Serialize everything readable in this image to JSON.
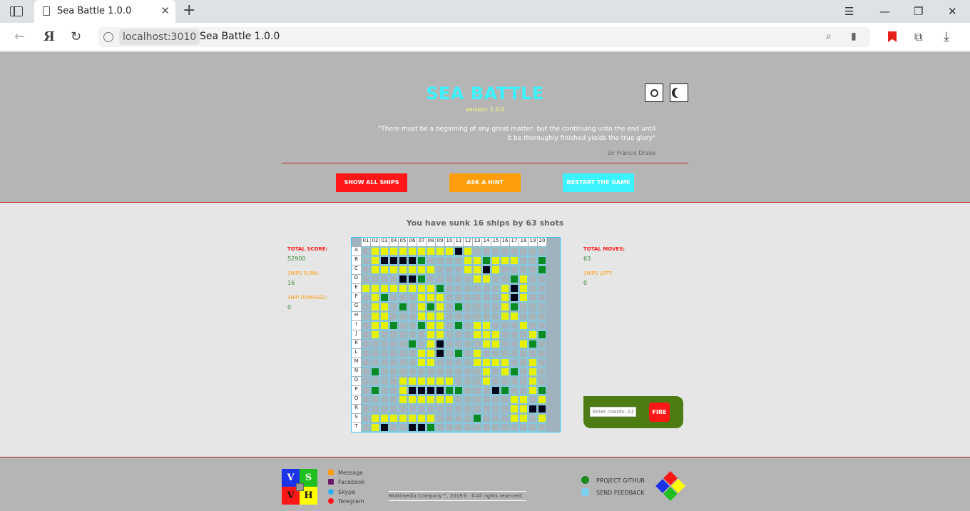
{
  "browser": {
    "tab_title": "Sea Battle 1.0.0",
    "address_host": "localhost:3010",
    "address_title": "Sea Battle 1.0.0"
  },
  "header": {
    "title": "SEA BATTLE",
    "version": "version: 1.0.0",
    "quote": "\"There must be a beginning of any great matter, but the continuing unto the end until it be thoroughly finished yields the true glory\"",
    "quote_author": "Sir Francis Drake",
    "buttons": {
      "show_all_ships": "SHOW ALL SHIPS",
      "ask_hint": "ASK A HINT",
      "restart": "RESTART THE GAME"
    },
    "colors": {
      "title": "#3cf2ff",
      "show_all_ships": "#ff1616",
      "ask_hint": "#ff9e0c",
      "restart": "#3cf2ff"
    }
  },
  "game": {
    "status": "You have sunk 16 ships by 63 shots",
    "stats": {
      "total_score_label": "TOTAL SCORE:",
      "total_score": "52900",
      "ships_sunk_label": "SHIPS SUNK:",
      "ships_sunk": "16",
      "ship_damages_label": "SHIP DAMAGES:",
      "ship_damages": "0",
      "total_moves_label": "TOTAL MOVES:",
      "total_moves": "63",
      "ships_left_label": "SHIPS LEFT:",
      "ships_left": "0"
    },
    "columns": [
      "01",
      "02",
      "03",
      "04",
      "05",
      "06",
      "07",
      "08",
      "09",
      "10",
      "11",
      "12",
      "13",
      "14",
      "15",
      "16",
      "17",
      "18",
      "19",
      "20"
    ],
    "rows": [
      "A",
      "B",
      "C",
      "D",
      "E",
      "F",
      "G",
      "H",
      "I",
      "J",
      "K",
      "L",
      "M",
      "N",
      "O",
      "P",
      "Q",
      "R",
      "S",
      "T"
    ],
    "cell_legend": {
      "e": "unopened",
      "y": "revealed",
      "k": "ship",
      "g": "hit"
    },
    "grid": [
      "eyyyyyyyyykyeeeeeeee",
      "eykkkkgeeeeyygyyyeeg",
      "eyyyyyyyeeeyykyeeeeg",
      "eeeekkgeeeeeyyeegyee",
      "yyyyyyyygeeeeeeykyee",
      "eygeeeyyyeeeeeeykyee",
      "eyyegeygyegeeeeygeee",
      "eyyeeeyyyeeeeeeyyeee",
      "eyygeegyyegeyyeeeyee",
      "eyeeeeeyyeeeyyyeeeyg",
      "eeeeegeykeeeeyyeeyge",
      "eeeeeeyykegeyeeeeeee",
      "eeeeeeyyeeeeyyyyeeye",
      "egeeeeeeeeeeeyeygeye",
      "eeeeyyyyyyeeeyeeeeye",
      "egeeykkkkggeeekgeeyg",
      "eeeeyyyyyyeeeeeeyyey",
      "eeeeeeeeeeeeeeeeyykk",
      "eyyyyyyyeeeegeeeyyey",
      "eykeekkgeeeeeeeeeeee"
    ],
    "fire": {
      "placeholder": "Enter coords: A1",
      "button": "FIRE"
    }
  },
  "footer": {
    "logo_letters": [
      "V",
      "S",
      "V",
      "H"
    ],
    "social": [
      "Message",
      "Facebook",
      "Skype",
      "Telegram"
    ],
    "copyright": "Multimedia Company™, 2019®. ©All rights reserved.",
    "links": {
      "github": "PROJECT GITHUB",
      "feedback": "SEND FEEDBACK"
    }
  }
}
